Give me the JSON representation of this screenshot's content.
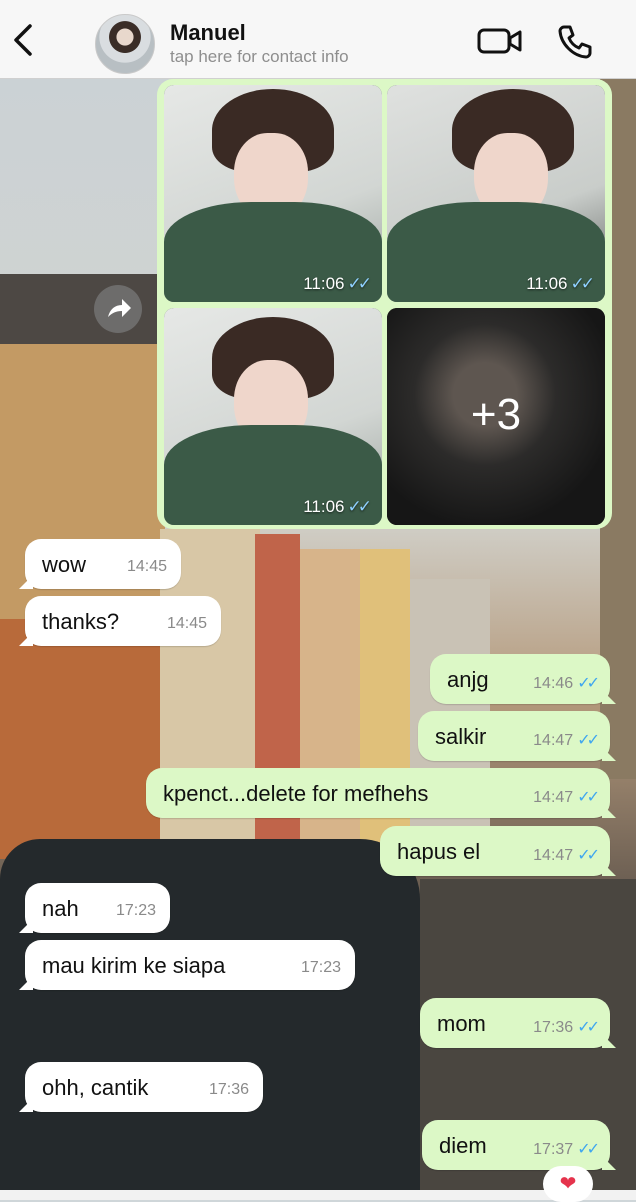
{
  "header": {
    "contact_name": "Manuel",
    "subtitle": "tap here for contact info",
    "icons": [
      "chevron-left-icon",
      "video-camera-icon",
      "phone-icon"
    ]
  },
  "media": {
    "photos": [
      {
        "time": "11:06"
      },
      {
        "time": "11:06"
      },
      {
        "time": "11:06"
      }
    ],
    "more_count": "+3",
    "tick": "✓✓"
  },
  "messages": [
    {
      "dir": "in",
      "text": "wow",
      "time": "14:45"
    },
    {
      "dir": "in",
      "text": "thanks?",
      "time": "14:45"
    },
    {
      "dir": "out",
      "text": "anjg",
      "time": "14:46"
    },
    {
      "dir": "out",
      "text": "salkir",
      "time": "14:47"
    },
    {
      "dir": "out",
      "text": "kpenct...delete for mefhehs",
      "time": "14:47"
    },
    {
      "dir": "out",
      "text": "hapus el",
      "time": "14:47"
    },
    {
      "dir": "in",
      "text": "nah",
      "time": "17:23"
    },
    {
      "dir": "in",
      "text": "mau kirim ke siapa",
      "time": "17:23"
    },
    {
      "dir": "out",
      "text": "mom",
      "time": "17:36"
    },
    {
      "dir": "in",
      "text": "ohh, cantik",
      "time": "17:36"
    },
    {
      "dir": "out",
      "text": "diem",
      "time": "17:37"
    }
  ],
  "reaction": "❤",
  "colors": {
    "outgoing_bubble": "#dcf8c6",
    "incoming_bubble": "#ffffff",
    "read_ticks": "#3fa6ef"
  }
}
